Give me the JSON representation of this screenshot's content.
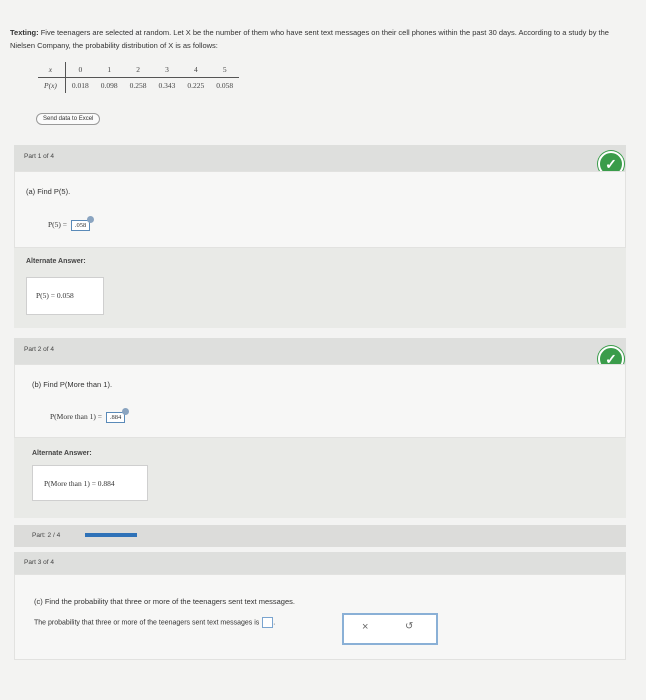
{
  "intro": {
    "label": "Texting:",
    "text": "Five teenagers are selected at random. Let X be the number of them who have sent text messages on their cell phones within the past 30 days. According to a study by the Nielsen Company, the probability distribution of X is as follows:"
  },
  "table": {
    "x_header": "x",
    "p_header": "P(x)",
    "x_values": [
      "0",
      "1",
      "2",
      "3",
      "4",
      "5"
    ],
    "p_values": [
      "0.018",
      "0.098",
      "0.258",
      "0.343",
      "0.225",
      "0.058"
    ]
  },
  "excel_button": "Send data to Excel",
  "part1": {
    "header": "Part 1 of 4",
    "question": "(a) Find P(5).",
    "answer_prefix": "P(5) =",
    "answer_value": ".058",
    "alt_label": "Alternate Answer:",
    "alt_answer": "P(5) = 0.058"
  },
  "part2": {
    "header": "Part 2 of 4",
    "question": "(b) Find P(More than 1).",
    "answer_prefix": "P(More than 1) =",
    "answer_value": ".884",
    "alt_label": "Alternate Answer:",
    "alt_answer": "P(More than 1) = 0.884"
  },
  "progress": {
    "label": "Part: 2 / 4",
    "fraction": 0.5
  },
  "part3": {
    "header": "Part 3 of 4",
    "question": "(c) Find the probability that three or more of the teenagers sent text messages.",
    "prompt": "The probability that three or more of the teenagers sent text messages is"
  },
  "actions": {
    "clear_glyph": "×",
    "undo_glyph": "↺"
  },
  "colors": {
    "check_green": "#3a9c4a",
    "progress_blue": "#2f72b8"
  }
}
